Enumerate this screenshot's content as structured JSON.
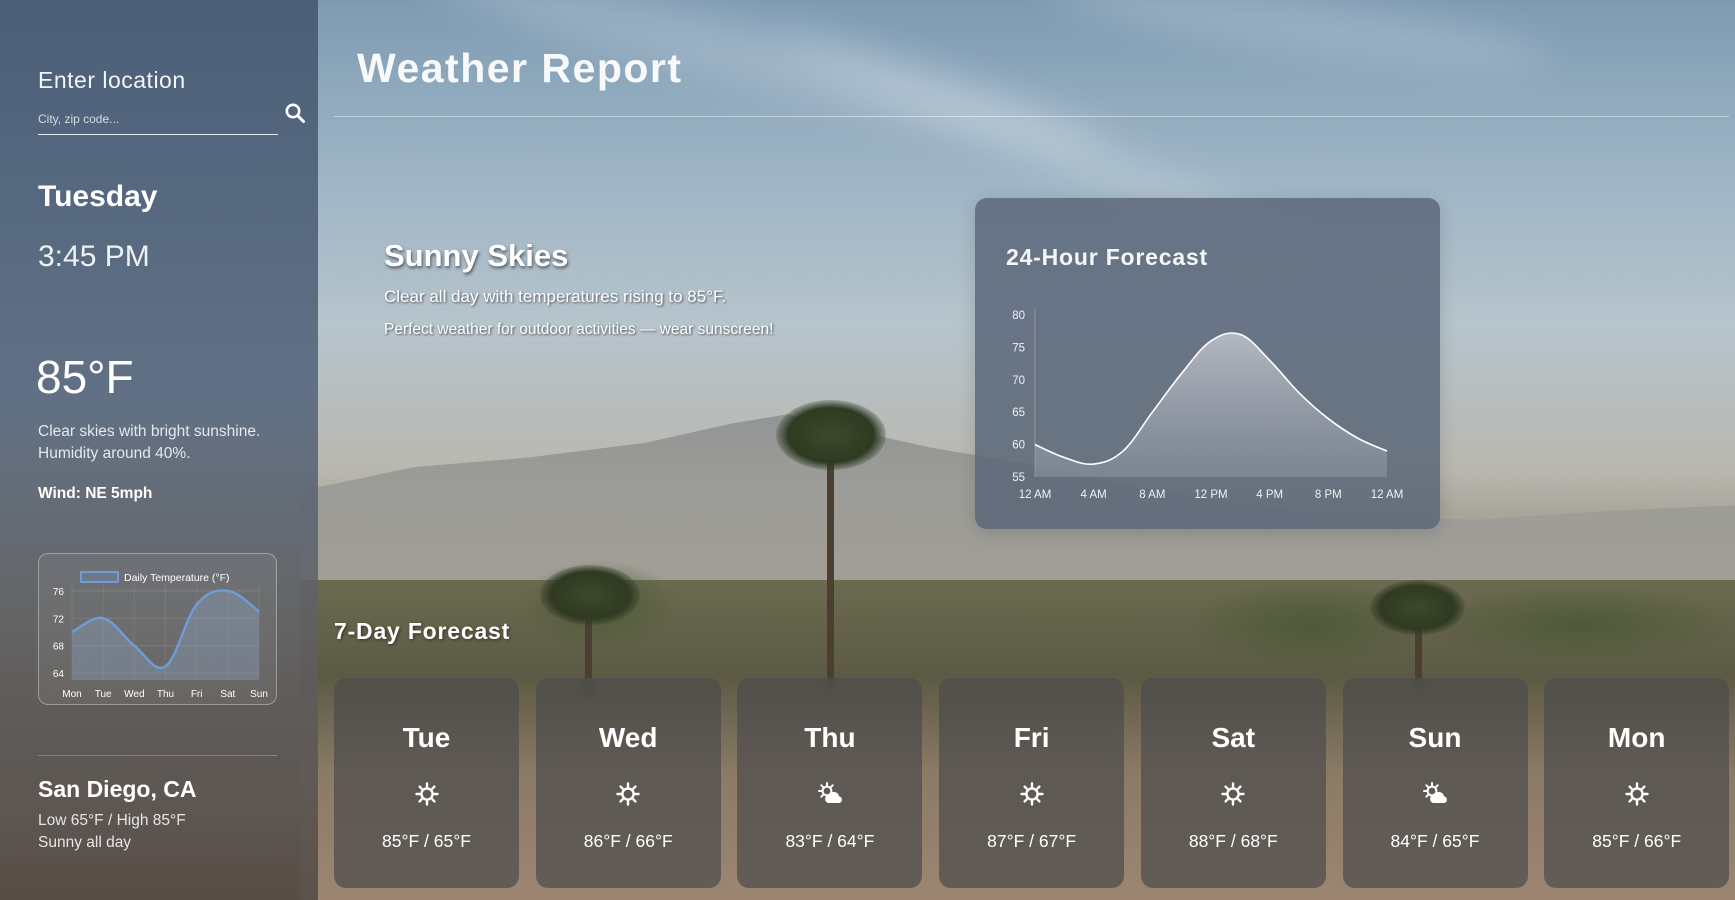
{
  "sidebar": {
    "location_label": "Enter location",
    "search": {
      "placeholder": "City, zip code...",
      "value": "",
      "icon": "search-icon"
    },
    "day": "Tuesday",
    "time": "3:45 PM",
    "temperature": "85°F",
    "description": "Clear skies with bright sunshine. Humidity around 40%.",
    "wind": "Wind: NE 5mph",
    "city": "San Diego, CA",
    "low_high": "Low 65°F / High 85°F",
    "summary": "Sunny all day"
  },
  "header": {
    "title": "Weather Report"
  },
  "hero": {
    "title": "Sunny Skies",
    "line1": "Clear all day with temperatures rising to 85°F.",
    "line2": "Perfect weather for outdoor activities — wear sunscreen!"
  },
  "mini_chart": {
    "type": "line",
    "legend": "Daily Temperature (°F)",
    "categories": [
      "Mon",
      "Tue",
      "Wed",
      "Thu",
      "Fri",
      "Sat",
      "Sun"
    ],
    "values": [
      70,
      72,
      68,
      65,
      74,
      76,
      73
    ],
    "y_ticks": [
      64,
      68,
      72,
      76
    ],
    "ylim": [
      63,
      77
    ],
    "color": "#6f9bd8"
  },
  "forecast_24h": {
    "title": "24-Hour Forecast",
    "chart_data": {
      "type": "area",
      "x": [
        "12 AM",
        "2 AM",
        "4 AM",
        "6 AM",
        "8 AM",
        "10 AM",
        "12 PM",
        "2 PM",
        "4 PM",
        "6 PM",
        "8 PM",
        "10 PM",
        "12 AM"
      ],
      "x_tick_labels": [
        "12 AM",
        "4 AM",
        "8 AM",
        "12 PM",
        "4 PM",
        "8 PM",
        "12 AM"
      ],
      "values": [
        60,
        58,
        57,
        59,
        65,
        71,
        76,
        77,
        73,
        68,
        64,
        61,
        59
      ],
      "y_ticks": [
        55,
        60,
        65,
        70,
        75,
        80
      ],
      "ylim": [
        55,
        80
      ],
      "grid": false
    }
  },
  "week": {
    "title": "7-Day Forecast",
    "days": [
      {
        "name": "Tue",
        "icon": "sun-icon",
        "temps": "85°F / 65°F"
      },
      {
        "name": "Wed",
        "icon": "sun-icon",
        "temps": "86°F / 66°F"
      },
      {
        "name": "Thu",
        "icon": "cloud-sun-icon",
        "temps": "83°F / 64°F"
      },
      {
        "name": "Fri",
        "icon": "sun-icon",
        "temps": "87°F / 67°F"
      },
      {
        "name": "Sat",
        "icon": "sun-icon",
        "temps": "88°F / 68°F"
      },
      {
        "name": "Sun",
        "icon": "cloud-sun-icon",
        "temps": "84°F / 65°F"
      },
      {
        "name": "Mon",
        "icon": "sun-icon",
        "temps": "85°F / 66°F"
      }
    ]
  }
}
